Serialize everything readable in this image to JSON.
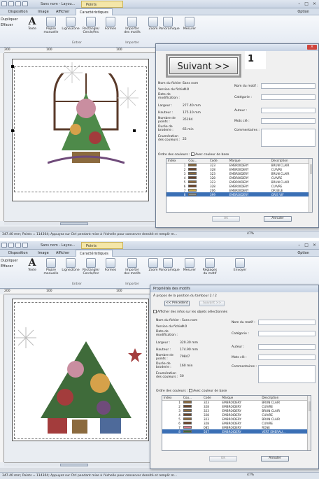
{
  "app": {
    "window_title": "Sans nom - Layou...",
    "context_tab": "Points",
    "tabs": [
      "Disposition",
      "Image",
      "Afficher",
      "Caractéristiques"
    ],
    "option_label": "Option",
    "ribbon": {
      "left_items": [
        "Dupliquer",
        "Effacer"
      ],
      "buttons": [
        "Texte",
        "Piqûre manuelle",
        "Ligne/Zone",
        "Rectangle/ Cercle/Arc",
        "Formes",
        "Importer des motifs",
        "Zoom",
        "Panoramique",
        "Mesurer",
        "Réglages du motif",
        "Envoyer"
      ],
      "group_entrer": "Entrer",
      "group_importer": "Importer"
    },
    "ruler_ticks": [
      "200",
      "100",
      "100"
    ],
    "status_text": "347.40 mm; Points = 114304; Appuyez sur Ctrl pendant mise à l'échelle pour conserver densité et remplir m...",
    "zoom": "47%"
  },
  "dialog1": {
    "next_button": "Suivant >>",
    "callout": "1",
    "fields": {
      "file_name_label": "Nom du fichier :",
      "file_name": "Sans nom",
      "version_label": "Version du fichier :",
      "version": "9.0",
      "mod_date_label": "Date de modification :",
      "width_label": "Largeur :",
      "width": "277.40 mm",
      "height_label": "Hauteur :",
      "height": "175.10 mm",
      "stitches_label": "Nombre de points :",
      "stitches": "35194",
      "time_label": "Durée de broderie :",
      "time": "65 min",
      "colors_label": "Énumération des couleurs :",
      "colors": "22",
      "motif_name_label": "Nom du motif :",
      "category_label": "Catégorie :",
      "author_label": "Auteur :",
      "keywords_label": "Mots clé :",
      "comments_label": "Commentaires :"
    },
    "color_order_label": "Ordre des couleurs :",
    "base_color_label": "Avec couleur de base",
    "table_headers": [
      "Index",
      "Cou...",
      "Code",
      "Marque",
      "Description"
    ],
    "rows": [
      {
        "index": "1",
        "color": "#8b6a3e",
        "code": "323",
        "brand": "EMBROIDERY",
        "desc": "BRUN CLAIR"
      },
      {
        "index": "2",
        "color": "#6b4226",
        "code": "328",
        "brand": "EMBROIDERY",
        "desc": "CUIVRE"
      },
      {
        "index": "3",
        "color": "#8b6a3e",
        "code": "323",
        "brand": "EMBROIDERY",
        "desc": "BRUN CLAIR"
      },
      {
        "index": "4",
        "color": "#6b4226",
        "code": "328",
        "brand": "EMBROIDERY",
        "desc": "CUIVRE"
      },
      {
        "index": "5",
        "color": "#8b6a3e",
        "code": "323",
        "brand": "EMBROIDERY",
        "desc": "BRUN CLAIR"
      },
      {
        "index": "6",
        "color": "#6b4226",
        "code": "328",
        "brand": "EMBROIDERY",
        "desc": "CUIVRE"
      },
      {
        "index": "7",
        "color": "#c9a646",
        "code": "206",
        "brand": "EMBROIDERY",
        "desc": "OR BILE"
      },
      {
        "index": "8",
        "color": "#8a8f8a",
        "code": "399",
        "brand": "EMBROIDERY",
        "desc": "GRIS VIF"
      }
    ],
    "ok": "OK",
    "cancel": "Annuler"
  },
  "dialog2": {
    "title": "Propriétés des motifs",
    "subtitle": "À propos de la position du tambour 2 / 2",
    "prev_button": "<< Précédent",
    "next_button": "Suivant >>",
    "show_selected_label": "Afficher des infos sur les objets sélectionnés",
    "fields": {
      "file_name_label": "Nom du fichier :",
      "file_name": "Sans nom",
      "version_label": "Version du fichier :",
      "version": "9.0",
      "mod_date_label": "Date de modification :",
      "width_label": "Largeur :",
      "width": "320.30 mm",
      "height_label": "Hauteur :",
      "height": "174.90 mm",
      "stitches_label": "Nombre de points :",
      "stitches": "79847",
      "time_label": "Durée de broderie :",
      "time": "160 min",
      "colors_label": "Énumération des couleurs :",
      "colors": "50",
      "motif_name_label": "Nom du motif :",
      "category_label": "Catégorie :",
      "author_label": "Auteur :",
      "keywords_label": "Mots clé :",
      "comments_label": "Commentaires :"
    },
    "color_order_label": "Ordre des couleurs :",
    "base_color_label": "Avec couleur de base",
    "table_headers": [
      "Index",
      "Cou...",
      "Code",
      "Marque",
      "Description"
    ],
    "rows": [
      {
        "index": "1",
        "color": "#8b6a3e",
        "code": "323",
        "brand": "EMBROIDERY",
        "desc": "BRUN CLAIR"
      },
      {
        "index": "2",
        "color": "#6b4226",
        "code": "328",
        "brand": "EMBROIDERY",
        "desc": "CUIVRE"
      },
      {
        "index": "3",
        "color": "#8b6a3e",
        "code": "323",
        "brand": "EMBROIDERY",
        "desc": "BRUN CLAIR"
      },
      {
        "index": "4",
        "color": "#6b4226",
        "code": "328",
        "brand": "EMBROIDERY",
        "desc": "CUIVRE"
      },
      {
        "index": "5",
        "color": "#8b6a3e",
        "code": "323",
        "brand": "EMBROIDERY",
        "desc": "BRUN CLAIR"
      },
      {
        "index": "6",
        "color": "#6b4226",
        "code": "328",
        "brand": "EMBROIDERY",
        "desc": "CUIVRE"
      },
      {
        "index": "7",
        "color": "#d87a8a",
        "code": "085",
        "brand": "EMBROIDERY",
        "desc": "ROSE"
      },
      {
        "index": "8",
        "color": "#3f6b3a",
        "code": "507",
        "brand": "EMBROIDERY",
        "desc": "VERT EMERAU..."
      }
    ],
    "ok": "OK",
    "cancel": "Annuler"
  }
}
